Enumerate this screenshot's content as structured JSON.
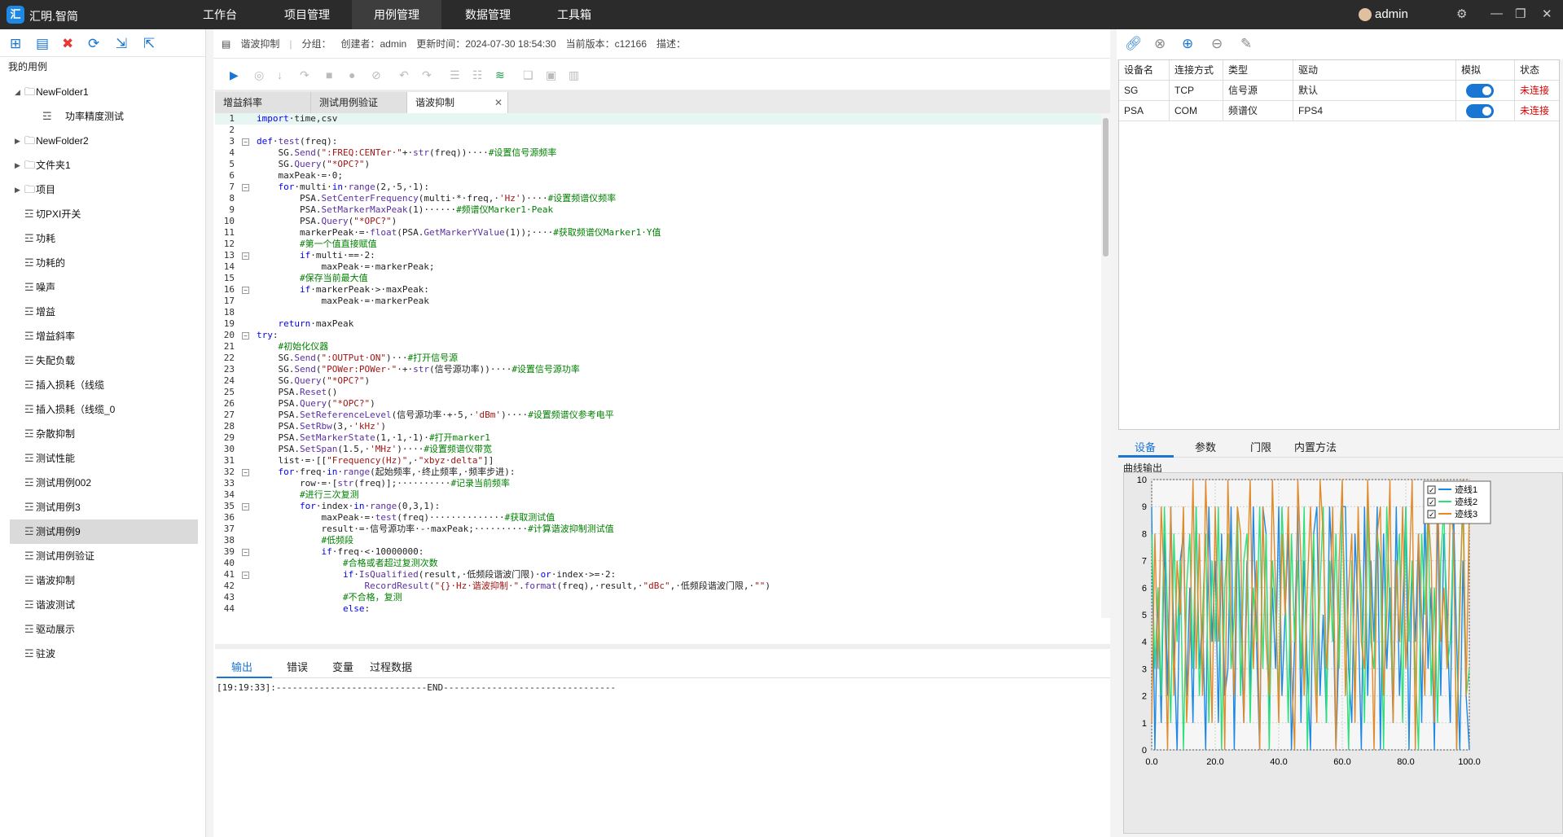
{
  "app": {
    "logo_text": "汇",
    "title": "汇明.智简",
    "user": "admin"
  },
  "menu": [
    "工作台",
    "项目管理",
    "用例管理",
    "数据管理",
    "工具箱"
  ],
  "left_panel": {
    "section_label": "我的用例"
  },
  "tree": [
    {
      "label": "NewFolder1",
      "level": 0,
      "type": "folder",
      "expanded": true
    },
    {
      "label": "功率精度测试",
      "level": 1,
      "type": "file"
    },
    {
      "label": "NewFolder2",
      "level": 0,
      "type": "folder",
      "expanded": false
    },
    {
      "label": "文件夹1",
      "level": 0,
      "type": "folder",
      "expanded": false
    },
    {
      "label": "项目",
      "level": 0,
      "type": "folder",
      "expanded": false
    },
    {
      "label": "切PXI开关",
      "level": 0,
      "type": "file"
    },
    {
      "label": "功耗",
      "level": 0,
      "type": "file"
    },
    {
      "label": "功耗的",
      "level": 0,
      "type": "file"
    },
    {
      "label": "噪声",
      "level": 0,
      "type": "file"
    },
    {
      "label": "增益",
      "level": 0,
      "type": "file"
    },
    {
      "label": "增益斜率",
      "level": 0,
      "type": "file"
    },
    {
      "label": "失配负载",
      "level": 0,
      "type": "file"
    },
    {
      "label": "插入损耗（线缆",
      "level": 0,
      "type": "file"
    },
    {
      "label": "插入损耗（线缆_0",
      "level": 0,
      "type": "file"
    },
    {
      "label": "杂散抑制",
      "level": 0,
      "type": "file"
    },
    {
      "label": "测试性能",
      "level": 0,
      "type": "file"
    },
    {
      "label": "测试用例002",
      "level": 0,
      "type": "file"
    },
    {
      "label": "测试用例3",
      "level": 0,
      "type": "file"
    },
    {
      "label": "测试用例9",
      "level": 0,
      "type": "file",
      "selected": true
    },
    {
      "label": "测试用例验证",
      "level": 0,
      "type": "file"
    },
    {
      "label": "谐波抑制",
      "level": 0,
      "type": "file"
    },
    {
      "label": "谐波测试",
      "level": 0,
      "type": "file"
    },
    {
      "label": "驱动展示",
      "level": 0,
      "type": "file"
    },
    {
      "label": "驻波",
      "level": 0,
      "type": "file"
    }
  ],
  "info": {
    "name": "谐波抑制",
    "group": "分组：",
    "creator": "创建者：admin",
    "updated": "更新时间：2024-07-30 18:54:30",
    "version": "当前版本：c12166",
    "desc": "描述："
  },
  "tabs": [
    {
      "label": "增益斜率"
    },
    {
      "label": "测试用例验证"
    },
    {
      "label": "谐波抑制",
      "active": true,
      "close": "✕"
    }
  ],
  "code_lines": [
    [
      [
        "kw",
        "import"
      ],
      [
        "",
        "·time,csv"
      ]
    ],
    [],
    [
      [
        "kw",
        "def"
      ],
      [
        "",
        "·"
      ],
      [
        "fn",
        "test"
      ],
      [
        "",
        "(freq):"
      ]
    ],
    [
      [
        "",
        "    SG."
      ],
      [
        "fn",
        "Send"
      ],
      [
        "",
        "("
      ],
      [
        "str",
        "\":FREQ:CENTer·\""
      ],
      [
        "",
        "+·"
      ],
      [
        "fn",
        "str"
      ],
      [
        "",
        "(freq))····"
      ],
      [
        "cm",
        "#设置信号源频率"
      ]
    ],
    [
      [
        "",
        "    SG."
      ],
      [
        "fn",
        "Query"
      ],
      [
        "",
        "("
      ],
      [
        "str",
        "\"*OPC?\""
      ],
      [
        "",
        ")"
      ]
    ],
    [
      [
        "",
        "    maxPeak·=·0;"
      ]
    ],
    [
      [
        "",
        "    "
      ],
      [
        "kw",
        "for"
      ],
      [
        "",
        "·multi·"
      ],
      [
        "kw",
        "in"
      ],
      [
        "",
        "·"
      ],
      [
        "fn",
        "range"
      ],
      [
        "",
        "(2,·5,·1):"
      ]
    ],
    [
      [
        "",
        "        PSA."
      ],
      [
        "fn",
        "SetCenterFrequency"
      ],
      [
        "",
        "(multi·*·freq,·"
      ],
      [
        "str",
        "'Hz'"
      ],
      [
        "",
        ")····"
      ],
      [
        "cm",
        "#设置频谱仪频率"
      ]
    ],
    [
      [
        "",
        "        PSA."
      ],
      [
        "fn",
        "SetMarkerMaxPeak"
      ],
      [
        "",
        "(1)······"
      ],
      [
        "cm",
        "#频谱仪Marker1·Peak"
      ]
    ],
    [
      [
        "",
        "        PSA."
      ],
      [
        "fn",
        "Query"
      ],
      [
        "",
        "("
      ],
      [
        "str",
        "\"*OPC?\""
      ],
      [
        "",
        ")"
      ]
    ],
    [
      [
        "",
        "        markerPeak·=·"
      ],
      [
        "fn",
        "float"
      ],
      [
        "",
        "(PSA."
      ],
      [
        "fn",
        "GetMarkerYValue"
      ],
      [
        "",
        "(1));····"
      ],
      [
        "cm",
        "#获取频谱仪Marker1·Y值"
      ]
    ],
    [
      [
        "",
        "        "
      ],
      [
        "cm",
        "#第一个值直接赋值"
      ]
    ],
    [
      [
        "",
        "        "
      ],
      [
        "kw",
        "if"
      ],
      [
        "",
        "·multi·==·2:"
      ]
    ],
    [
      [
        "",
        "            maxPeak·=·markerPeak;"
      ]
    ],
    [
      [
        "",
        "        "
      ],
      [
        "cm",
        "#保存当前最大值"
      ]
    ],
    [
      [
        "",
        "        "
      ],
      [
        "kw",
        "if"
      ],
      [
        "",
        "·markerPeak·>·maxPeak:"
      ]
    ],
    [
      [
        "",
        "            maxPeak·=·markerPeak"
      ]
    ],
    [],
    [
      [
        "",
        "    "
      ],
      [
        "kw",
        "return"
      ],
      [
        "",
        "·maxPeak"
      ]
    ],
    [
      [
        "kw",
        "try"
      ],
      [
        "",
        ":"
      ]
    ],
    [
      [
        "",
        "    "
      ],
      [
        "cm",
        "#初始化仪器"
      ]
    ],
    [
      [
        "",
        "    SG."
      ],
      [
        "fn",
        "Send"
      ],
      [
        "",
        "("
      ],
      [
        "str",
        "\":OUTPut·ON\""
      ],
      [
        "",
        ")···"
      ],
      [
        "cm",
        "#打开信号源"
      ]
    ],
    [
      [
        "",
        "    SG."
      ],
      [
        "fn",
        "Send"
      ],
      [
        "",
        "("
      ],
      [
        "str",
        "\"POWer:POWer·\""
      ],
      [
        "",
        "·+·"
      ],
      [
        "fn",
        "str"
      ],
      [
        "",
        "(信号源功率))····"
      ],
      [
        "cm",
        "#设置信号源功率"
      ]
    ],
    [
      [
        "",
        "    SG."
      ],
      [
        "fn",
        "Query"
      ],
      [
        "",
        "("
      ],
      [
        "str",
        "\"*OPC?\""
      ],
      [
        "",
        ")"
      ]
    ],
    [
      [
        "",
        "    PSA."
      ],
      [
        "fn",
        "Reset"
      ],
      [
        "",
        "()"
      ]
    ],
    [
      [
        "",
        "    PSA."
      ],
      [
        "fn",
        "Query"
      ],
      [
        "",
        "("
      ],
      [
        "str",
        "\"*OPC?\""
      ],
      [
        "",
        ")"
      ]
    ],
    [
      [
        "",
        "    PSA."
      ],
      [
        "fn",
        "SetReferenceLevel"
      ],
      [
        "",
        "(信号源功率·+·5,·"
      ],
      [
        "str",
        "'dBm'"
      ],
      [
        "",
        ")····"
      ],
      [
        "cm",
        "#设置频谱仪参考电平"
      ]
    ],
    [
      [
        "",
        "    PSA."
      ],
      [
        "fn",
        "SetRbw"
      ],
      [
        "",
        "(3,·"
      ],
      [
        "str",
        "'kHz'"
      ],
      [
        "",
        ")"
      ]
    ],
    [
      [
        "",
        "    PSA."
      ],
      [
        "fn",
        "SetMarkerState"
      ],
      [
        "",
        "(1,·1,·1)·"
      ],
      [
        "cm",
        "#打开marker1"
      ]
    ],
    [
      [
        "",
        "    PSA."
      ],
      [
        "fn",
        "SetSpan"
      ],
      [
        "",
        "(1.5,·"
      ],
      [
        "str",
        "'MHz'"
      ],
      [
        "",
        ")····"
      ],
      [
        "cm",
        "#设置频谱仪带宽"
      ]
    ],
    [
      [
        "",
        "    list·=·[["
      ],
      [
        "str",
        "\"Frequency(Hz)\""
      ],
      [
        "",
        ",·"
      ],
      [
        "str",
        "\"xbyz·delta\""
      ],
      [
        "",
        "]]"
      ]
    ],
    [
      [
        "",
        "    "
      ],
      [
        "kw",
        "for"
      ],
      [
        "",
        "·freq·"
      ],
      [
        "kw",
        "in"
      ],
      [
        "",
        "·"
      ],
      [
        "fn",
        "range"
      ],
      [
        "",
        "(起始频率,·终止频率,·频率步进):"
      ]
    ],
    [
      [
        "",
        "        row·=·["
      ],
      [
        "fn",
        "str"
      ],
      [
        "",
        "(freq)];··········"
      ],
      [
        "cm",
        "#记录当前频率"
      ]
    ],
    [
      [
        "",
        "        "
      ],
      [
        "cm",
        "#进行三次复测"
      ]
    ],
    [
      [
        "",
        "        "
      ],
      [
        "kw",
        "for"
      ],
      [
        "",
        "·index·"
      ],
      [
        "kw",
        "in"
      ],
      [
        "",
        "·"
      ],
      [
        "fn",
        "range"
      ],
      [
        "",
        "(0,3,1):"
      ]
    ],
    [
      [
        "",
        "            maxPeak·=·"
      ],
      [
        "fn",
        "test"
      ],
      [
        "",
        "(freq)··············"
      ],
      [
        "cm",
        "#获取测试值"
      ]
    ],
    [
      [
        "",
        "            result·=·信号源功率·-·maxPeak;··········"
      ],
      [
        "cm",
        "#计算谐波抑制测试值"
      ]
    ],
    [
      [
        "",
        "            "
      ],
      [
        "cm",
        "#低频段"
      ]
    ],
    [
      [
        "",
        "            "
      ],
      [
        "kw",
        "if"
      ],
      [
        "",
        "·freq·<·10000000:"
      ]
    ],
    [
      [
        "",
        "                "
      ],
      [
        "cm",
        "#合格或者超过复测次数"
      ]
    ],
    [
      [
        "",
        "                "
      ],
      [
        "kw",
        "if"
      ],
      [
        "",
        "·"
      ],
      [
        "fn",
        "IsQualified"
      ],
      [
        "",
        "(result,·低频段谐波门限)·"
      ],
      [
        "kw",
        "or"
      ],
      [
        "",
        "·index·>=·2:"
      ]
    ],
    [
      [
        "",
        "                    "
      ],
      [
        "fn",
        "RecordResult"
      ],
      [
        "",
        "("
      ],
      [
        "str",
        "\"{}·Hz·谐波抑制·\""
      ],
      [
        "",
        "."
      ],
      [
        "fn",
        "format"
      ],
      [
        "",
        "(freq),·result,·"
      ],
      [
        "str",
        "\"dBc\""
      ],
      [
        "",
        ",·低频段谐波门限,·"
      ],
      [
        "str",
        "\"\""
      ],
      [
        "",
        ")"
      ]
    ],
    [
      [
        "",
        "                "
      ],
      [
        "cm",
        "#不合格，复测"
      ]
    ],
    [
      [
        "",
        "                "
      ],
      [
        "kw",
        "else"
      ],
      [
        "",
        ":"
      ]
    ]
  ],
  "fold_lines": [
    3,
    7,
    13,
    16,
    20,
    32,
    35,
    39,
    41
  ],
  "bottom_tabs": [
    "输出",
    "错误",
    "变量",
    "过程数据"
  ],
  "output_text": "[19:19:33]:----------------------------END--------------------------------",
  "device_table": {
    "headers": [
      "设备名",
      "连接方式",
      "类型",
      "驱动",
      "模拟",
      "状态"
    ],
    "rows": [
      {
        "name": "SG",
        "conn": "TCP",
        "type": "信号源",
        "driver": "默认",
        "sim": true,
        "status": "未连接"
      },
      {
        "name": "PSA",
        "conn": "COM",
        "type": "频谱仪",
        "driver": "FPS4",
        "sim": true,
        "status": "未连接"
      }
    ]
  },
  "right_tabs": [
    "设备",
    "参数",
    "门限",
    "内置方法"
  ],
  "plot_title": "曲线输出",
  "colors": {
    "trace1": "#1e88e5",
    "trace2": "#2ee07a",
    "trace3": "#e08a2a",
    "accent": "#1976d2",
    "status_red": "#e00000"
  },
  "chart_data": {
    "type": "line",
    "xlim": [
      0,
      100
    ],
    "ylim": [
      0,
      10
    ],
    "x_ticks": [
      "0.0",
      "20.0",
      "40.0",
      "60.0",
      "80.0",
      "100.0"
    ],
    "y_ticks": [
      "0",
      "1",
      "2",
      "3",
      "4",
      "5",
      "6",
      "7",
      "8",
      "9",
      "10"
    ],
    "grid": true,
    "legend_position": "top-right",
    "series": [
      {
        "name": "迹线1",
        "values": [
          9,
          0,
          6,
          1,
          8,
          2,
          9,
          4,
          0,
          7,
          8,
          2,
          6,
          1,
          9,
          3,
          5,
          0,
          9,
          4,
          7,
          1,
          8,
          2,
          3,
          9,
          0,
          8,
          5,
          1,
          7,
          2,
          9,
          4,
          0,
          9,
          8,
          1,
          6,
          3,
          9,
          2,
          5,
          8,
          0,
          4,
          9,
          1,
          7,
          3,
          0,
          8,
          9,
          2,
          5,
          1,
          9,
          6,
          0,
          4,
          9,
          9,
          3,
          1,
          8,
          5,
          0,
          9,
          2,
          7,
          4,
          9,
          0,
          8,
          3,
          6,
          1,
          9,
          2,
          5,
          9,
          0,
          7,
          4,
          8,
          1,
          9,
          3,
          6,
          0,
          9,
          2,
          8,
          5,
          1,
          9,
          4,
          0,
          7,
          2,
          0
        ]
      },
      {
        "name": "迹线2",
        "values": [
          8,
          3,
          6,
          2,
          9,
          5,
          1,
          8,
          4,
          7,
          0,
          6,
          8,
          3,
          9,
          2,
          5,
          8,
          1,
          7,
          4,
          9,
          0,
          6,
          8,
          3,
          5,
          9,
          2,
          7,
          8,
          1,
          6,
          4,
          9,
          3,
          8,
          0,
          7,
          5,
          2,
          9,
          6,
          1,
          8,
          4,
          7,
          3,
          9,
          0,
          5,
          8,
          2,
          6,
          9,
          1,
          7,
          4,
          8,
          3,
          9,
          5,
          0,
          7,
          2,
          8,
          6,
          1,
          9,
          4,
          3,
          8,
          7,
          0,
          9,
          5,
          2,
          6,
          8,
          1,
          9,
          4,
          7,
          3,
          0,
          8,
          5,
          9,
          2,
          6,
          1,
          7,
          9,
          3,
          4,
          8,
          0,
          6,
          9,
          2,
          3
        ]
      },
      {
        "name": "迹线3",
        "values": [
          1,
          8,
          3,
          9,
          6,
          0,
          9,
          2,
          7,
          5,
          9,
          1,
          4,
          10,
          3,
          8,
          2,
          10,
          6,
          1,
          9,
          4,
          7,
          0,
          10,
          5,
          2,
          9,
          8,
          1,
          6,
          10,
          3,
          7,
          0,
          9,
          4,
          2,
          10,
          6,
          1,
          8,
          5,
          9,
          3,
          0,
          10,
          7,
          2,
          6,
          9,
          4,
          1,
          10,
          8,
          3,
          5,
          9,
          0,
          7,
          10,
          2,
          6,
          8,
          1,
          9,
          4,
          3,
          10,
          6,
          0,
          8,
          9,
          2,
          5,
          10,
          1,
          7,
          4,
          9,
          3,
          6,
          10,
          0,
          8,
          5,
          2,
          9,
          7,
          1,
          10,
          4,
          6,
          3,
          9,
          8,
          0,
          5,
          10,
          2,
          9
        ]
      }
    ]
  }
}
